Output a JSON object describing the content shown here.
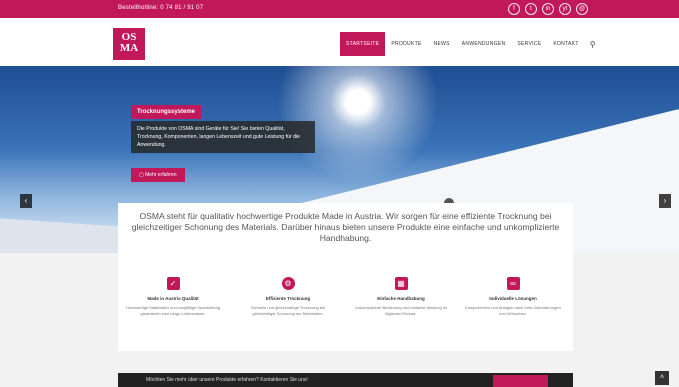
{
  "topbar": {
    "phone": "Bestellhotline: 0 74 81 / 91 07",
    "social": [
      "f",
      "t",
      "in",
      "yt",
      "@"
    ]
  },
  "logo": {
    "line1": "OS",
    "line2": "MA"
  },
  "nav": {
    "items": [
      "STARTSEITE",
      "PRODUKTE",
      "NEWS",
      "ANWENDUNGEN",
      "SERVICE",
      "KONTAKT"
    ],
    "active_index": 0,
    "search_icon": "search-icon"
  },
  "hero": {
    "title": "Trocknungssysteme",
    "text": "Die Produkte von OSMA sind Geräte für Sie! Sie bieten Qualität, Trocknung, Komponenten, langen Lebenszeit und gute Leistung für die Anwendung.",
    "button": "Mehr erfahren",
    "prev_icon": "chevron-left-icon",
    "next_icon": "chevron-right-icon"
  },
  "intro": "OSMA steht für qualitativ hochwertige Produkte Made in Austria. Wir sorgen für eine effiziente Trocknung bei gleichzeitiger Schonung des Materials. Darüber hinaus bieten unsere Produkte eine einfache und unkomplizierte Handhabung.",
  "features": [
    {
      "icon": "checkbox-icon",
      "title": "Made in Austria Qualität",
      "desc": "Hochwertige Materialien und sorgfältige Verarbeitung garantieren eine lange Lebensdauer."
    },
    {
      "icon": "gear-icon",
      "title": "Effiziente Trocknung",
      "desc": "Schnelle und gleichmäßige Trocknung bei gleichzeitiger Schonung der Materialien."
    },
    {
      "icon": "grid-icon",
      "title": "Einfache Handhabung",
      "desc": "Unkomplizierte Bedienung und einfache Wartung im täglichen Einsatz."
    },
    {
      "icon": "share-icon",
      "title": "Individuelle Lösungen",
      "desc": "Komponenten und Anlagen nach Ihren Anforderungen und Wünschen."
    }
  ],
  "bottom": {
    "text": "Möchten Sie mehr über unsere Produkte erfahren? Kontaktieren Sie uns!"
  },
  "colors": {
    "accent": "#c1185a",
    "dark": "#222222"
  }
}
